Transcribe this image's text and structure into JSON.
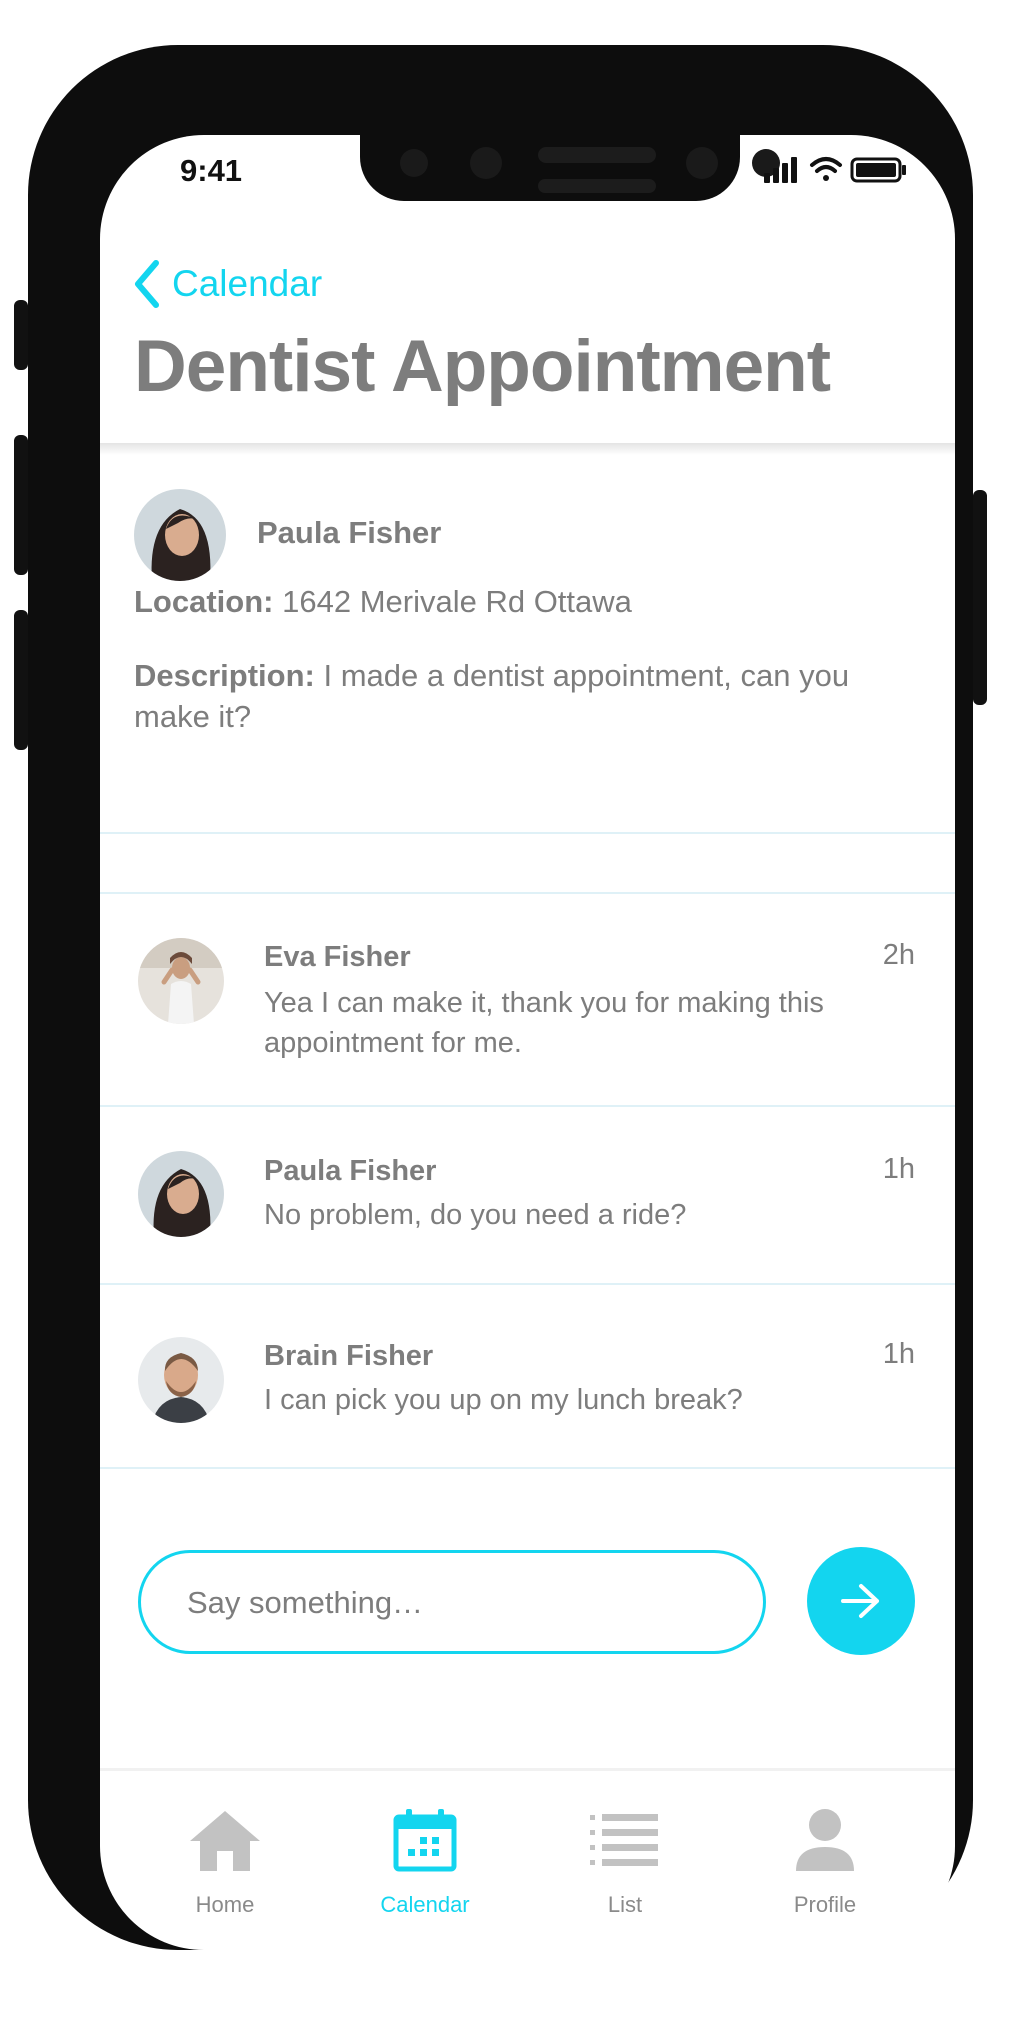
{
  "status_bar": {
    "time": "9:41"
  },
  "header": {
    "back_label": "Calendar",
    "title": "Dentist Appointment"
  },
  "event": {
    "owner": "Paula Fisher",
    "location_label": "Location:",
    "location": "1642 Merivale Rd Ottawa",
    "description_label": "Description:",
    "description": "I made a dentist appointment, can you make it?"
  },
  "comments": [
    {
      "name": "Eva Fisher",
      "time": "2h",
      "text": "Yea I can make it, thank you for making this appointment for me."
    },
    {
      "name": "Paula Fisher",
      "time": "1h",
      "text": "No problem, do you need a ride?"
    },
    {
      "name": "Brain Fisher",
      "time": "1h",
      "text": "I can pick you up on my lunch break?"
    }
  ],
  "composer": {
    "placeholder": "Say something…"
  },
  "tabs": [
    {
      "label": "Home",
      "icon": "home-icon"
    },
    {
      "label": "Calendar",
      "icon": "calendar-icon",
      "active": true
    },
    {
      "label": "List",
      "icon": "list-icon"
    },
    {
      "label": "Profile",
      "icon": "profile-icon"
    }
  ],
  "colors": {
    "accent": "#13d5ef",
    "text": "#7d7d7d",
    "frame": "#0d0d0d"
  }
}
